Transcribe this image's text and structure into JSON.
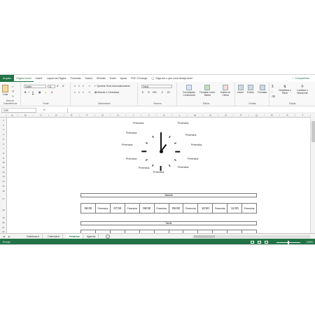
{
  "ribbon_tabs": [
    "Arquivo",
    "Página Inicial",
    "Inserir",
    "Layout da Página",
    "Fórmulas",
    "Dados",
    "Revisão",
    "Exibir",
    "Ajuda",
    "PDF-XChange"
  ],
  "tell_me": "Diga-me o que você deseja fazer",
  "share": "Compartilhar",
  "ribbon": {
    "paste": "Colar",
    "font_name": "Calibri",
    "font_size": "11",
    "wrap_text": "Quebrar Texto Automaticamente",
    "merge_center": "Mesclar e Centralizar",
    "number_format": "Geral",
    "cond_format": "Formatação Condicional",
    "format_table": "Formatar como Tabela",
    "cell_styles": "Estilos de Célula",
    "insert": "Inserir",
    "delete": "Excluir",
    "format": "Formatar",
    "sort_filter": "Classificar e Filtrar",
    "find_select": "Localizar e Selecionar",
    "groups": [
      "Área de Transferência",
      "Fonte",
      "Alinhamento",
      "Número",
      "Estilos",
      "Células",
      "Edição"
    ]
  },
  "formula_bar": {
    "name_box": "G39",
    "fx": "fx",
    "formula": ""
  },
  "columns": [
    "A",
    "B",
    "C",
    "D",
    "E",
    "F",
    "G",
    "H",
    "I",
    "J",
    "K",
    "L",
    "M",
    "N",
    "O",
    "P",
    "Q",
    "R",
    "S",
    "T"
  ],
  "rows": [
    "1",
    "2",
    "3",
    "4",
    "5",
    "6",
    "7",
    "8",
    "9",
    "10",
    "11",
    "12",
    "13",
    "14",
    "15",
    "16",
    "17",
    "18",
    "19",
    "20",
    "21",
    "22",
    "23"
  ],
  "clock_labels": [
    "Preencha",
    "Preencha",
    "Preencha",
    "Preencha",
    "Preencha",
    "Preencha",
    "Preencha",
    "Preencha",
    "Preencha",
    "Preencha",
    "Preencha",
    "Preencha"
  ],
  "morning": {
    "title": "Manhã",
    "slots": [
      {
        "time": "06:00",
        "fill": "Preencha"
      },
      {
        "time": "07:00",
        "fill": "Preencha"
      },
      {
        "time": "08:00",
        "fill": "Preencha"
      },
      {
        "time": "09:00",
        "fill": "Preencha"
      },
      {
        "time": "10:00",
        "fill": "Preencha"
      },
      {
        "time": "11:00",
        "fill": "Preencha"
      }
    ]
  },
  "afternoon": {
    "title": "Tarde"
  },
  "sheet_tabs": [
    "Dashboard",
    "Calendário",
    "Horários",
    "Agenda"
  ],
  "active_sheet": "Horários",
  "status": {
    "ready": "Pronto",
    "zoom": "100%"
  },
  "colors": {
    "excel_green": "#217346"
  }
}
